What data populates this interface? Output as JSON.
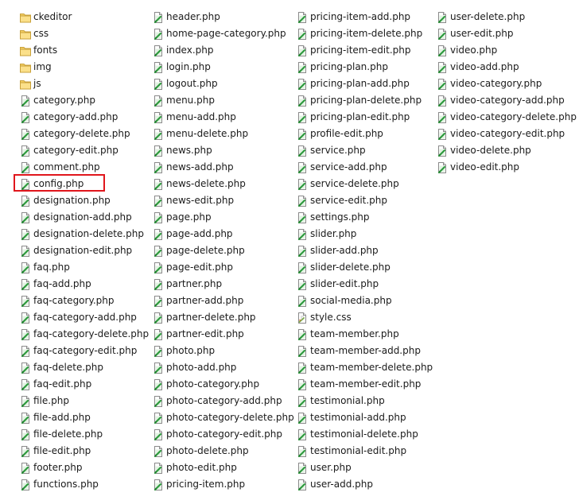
{
  "highlight_color": "#e0161c",
  "selected_item": "config.php",
  "columns": [
    {
      "items": [
        {
          "name": "ckeditor",
          "type": "folder"
        },
        {
          "name": "css",
          "type": "folder"
        },
        {
          "name": "fonts",
          "type": "folder"
        },
        {
          "name": "img",
          "type": "folder"
        },
        {
          "name": "js",
          "type": "folder"
        },
        {
          "name": "category.php",
          "type": "php"
        },
        {
          "name": "category-add.php",
          "type": "php"
        },
        {
          "name": "category-delete.php",
          "type": "php"
        },
        {
          "name": "category-edit.php",
          "type": "php"
        },
        {
          "name": "comment.php",
          "type": "php"
        },
        {
          "name": "config.php",
          "type": "php"
        },
        {
          "name": "designation.php",
          "type": "php"
        },
        {
          "name": "designation-add.php",
          "type": "php"
        },
        {
          "name": "designation-delete.php",
          "type": "php"
        },
        {
          "name": "designation-edit.php",
          "type": "php"
        },
        {
          "name": "faq.php",
          "type": "php"
        },
        {
          "name": "faq-add.php",
          "type": "php"
        },
        {
          "name": "faq-category.php",
          "type": "php"
        },
        {
          "name": "faq-category-add.php",
          "type": "php"
        },
        {
          "name": "faq-category-delete.php",
          "type": "php"
        },
        {
          "name": "faq-category-edit.php",
          "type": "php"
        },
        {
          "name": "faq-delete.php",
          "type": "php"
        },
        {
          "name": "faq-edit.php",
          "type": "php"
        },
        {
          "name": "file.php",
          "type": "php"
        },
        {
          "name": "file-add.php",
          "type": "php"
        },
        {
          "name": "file-delete.php",
          "type": "php"
        },
        {
          "name": "file-edit.php",
          "type": "php"
        },
        {
          "name": "footer.php",
          "type": "php"
        },
        {
          "name": "functions.php",
          "type": "php"
        }
      ]
    },
    {
      "items": [
        {
          "name": "header.php",
          "type": "php"
        },
        {
          "name": "home-page-category.php",
          "type": "php"
        },
        {
          "name": "index.php",
          "type": "php"
        },
        {
          "name": "login.php",
          "type": "php"
        },
        {
          "name": "logout.php",
          "type": "php"
        },
        {
          "name": "menu.php",
          "type": "php"
        },
        {
          "name": "menu-add.php",
          "type": "php"
        },
        {
          "name": "menu-delete.php",
          "type": "php"
        },
        {
          "name": "news.php",
          "type": "php"
        },
        {
          "name": "news-add.php",
          "type": "php"
        },
        {
          "name": "news-delete.php",
          "type": "php"
        },
        {
          "name": "news-edit.php",
          "type": "php"
        },
        {
          "name": "page.php",
          "type": "php"
        },
        {
          "name": "page-add.php",
          "type": "php"
        },
        {
          "name": "page-delete.php",
          "type": "php"
        },
        {
          "name": "page-edit.php",
          "type": "php"
        },
        {
          "name": "partner.php",
          "type": "php"
        },
        {
          "name": "partner-add.php",
          "type": "php"
        },
        {
          "name": "partner-delete.php",
          "type": "php"
        },
        {
          "name": "partner-edit.php",
          "type": "php"
        },
        {
          "name": "photo.php",
          "type": "php"
        },
        {
          "name": "photo-add.php",
          "type": "php"
        },
        {
          "name": "photo-category.php",
          "type": "php"
        },
        {
          "name": "photo-category-add.php",
          "type": "php"
        },
        {
          "name": "photo-category-delete.php",
          "type": "php"
        },
        {
          "name": "photo-category-edit.php",
          "type": "php"
        },
        {
          "name": "photo-delete.php",
          "type": "php"
        },
        {
          "name": "photo-edit.php",
          "type": "php"
        },
        {
          "name": "pricing-item.php",
          "type": "php"
        }
      ]
    },
    {
      "items": [
        {
          "name": "pricing-item-add.php",
          "type": "php"
        },
        {
          "name": "pricing-item-delete.php",
          "type": "php"
        },
        {
          "name": "pricing-item-edit.php",
          "type": "php"
        },
        {
          "name": "pricing-plan.php",
          "type": "php"
        },
        {
          "name": "pricing-plan-add.php",
          "type": "php"
        },
        {
          "name": "pricing-plan-delete.php",
          "type": "php"
        },
        {
          "name": "pricing-plan-edit.php",
          "type": "php"
        },
        {
          "name": "profile-edit.php",
          "type": "php"
        },
        {
          "name": "service.php",
          "type": "php"
        },
        {
          "name": "service-add.php",
          "type": "php"
        },
        {
          "name": "service-delete.php",
          "type": "php"
        },
        {
          "name": "service-edit.php",
          "type": "php"
        },
        {
          "name": "settings.php",
          "type": "php"
        },
        {
          "name": "slider.php",
          "type": "php"
        },
        {
          "name": "slider-add.php",
          "type": "php"
        },
        {
          "name": "slider-delete.php",
          "type": "php"
        },
        {
          "name": "slider-edit.php",
          "type": "php"
        },
        {
          "name": "social-media.php",
          "type": "php"
        },
        {
          "name": "style.css",
          "type": "css"
        },
        {
          "name": "team-member.php",
          "type": "php"
        },
        {
          "name": "team-member-add.php",
          "type": "php"
        },
        {
          "name": "team-member-delete.php",
          "type": "php"
        },
        {
          "name": "team-member-edit.php",
          "type": "php"
        },
        {
          "name": "testimonial.php",
          "type": "php"
        },
        {
          "name": "testimonial-add.php",
          "type": "php"
        },
        {
          "name": "testimonial-delete.php",
          "type": "php"
        },
        {
          "name": "testimonial-edit.php",
          "type": "php"
        },
        {
          "name": "user.php",
          "type": "php"
        },
        {
          "name": "user-add.php",
          "type": "php"
        }
      ]
    },
    {
      "items": [
        {
          "name": "user-delete.php",
          "type": "php"
        },
        {
          "name": "user-edit.php",
          "type": "php"
        },
        {
          "name": "video.php",
          "type": "php"
        },
        {
          "name": "video-add.php",
          "type": "php"
        },
        {
          "name": "video-category.php",
          "type": "php"
        },
        {
          "name": "video-category-add.php",
          "type": "php"
        },
        {
          "name": "video-category-delete.php",
          "type": "php"
        },
        {
          "name": "video-category-edit.php",
          "type": "php"
        },
        {
          "name": "video-delete.php",
          "type": "php"
        },
        {
          "name": "video-edit.php",
          "type": "php"
        }
      ]
    }
  ]
}
